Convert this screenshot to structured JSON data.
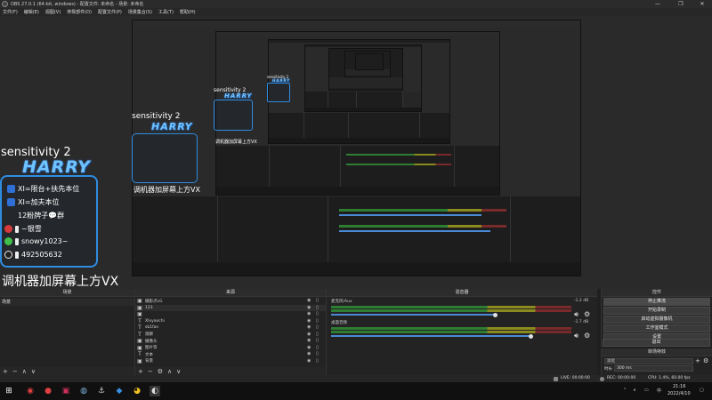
{
  "window": {
    "title": "OBS 27.0.1 (64-bit, windows) - 配置文件: 未命名 - 场景: 未命名",
    "controls": [
      "—",
      "❐",
      "✕"
    ]
  },
  "menu": [
    "文件(F)",
    "编辑(E)",
    "视图(V)",
    "停靠部件(D)",
    "配置文件(P)",
    "场景集合(S)",
    "工具(T)",
    "帮助(H)"
  ],
  "overlay": {
    "sensitivity": "sensitivity 2",
    "logo_text": "HARRY",
    "rows": [
      "XI=限台+扶先本位",
      "XI=加夫本位",
      "12粉牌子💬群",
      "~银雪",
      "snowy1023~",
      "492505632"
    ],
    "banner": "调机器加屏幕上方VX"
  },
  "docks": {
    "scenes": {
      "title": "场景",
      "items": [
        "场景"
      ],
      "footer": [
        "+",
        "−",
        "∧",
        "∨"
      ]
    },
    "sources": {
      "title": "来源",
      "items": [
        {
          "icon": "image",
          "label": "摄影点LG"
        },
        {
          "icon": "image",
          "label": "123"
        },
        {
          "icon": "image",
          "label": ""
        },
        {
          "icon": "text",
          "label": "XIxyaochi"
        },
        {
          "icon": "text",
          "label": "sb1fan"
        },
        {
          "icon": "text",
          "label": "观察"
        },
        {
          "icon": "image",
          "label": "摄像头"
        },
        {
          "icon": "image",
          "label": "图片等"
        },
        {
          "icon": "text",
          "label": "文本"
        },
        {
          "icon": "image",
          "label": "背景"
        }
      ],
      "footer": [
        "+",
        "−",
        "⚙",
        "∧",
        "∨"
      ]
    },
    "mixer": {
      "title": "混音器",
      "channels": [
        {
          "name": "麦克风/Aux",
          "db": "-1.2 dB",
          "volume": 0.68
        },
        {
          "name": "桌面音频",
          "db": "-1.7 dB",
          "volume": 0.83
        }
      ]
    },
    "controls": {
      "title": "控件",
      "buttons": [
        "停止推流",
        "开始录制",
        "启动虚拟摄像机",
        "工作室模式",
        "设置",
        "退出"
      ]
    },
    "transitions": {
      "title": "转场特效",
      "type": "淡化",
      "duration_label": "时长",
      "duration_value": "300 ms"
    }
  },
  "status": {
    "live": "LIVE: 00:00:00",
    "rec": "REC: 00:00:00",
    "cpu": "CPU: 1.4%, 60.00 fps"
  },
  "taskbar": {
    "time": "21:16",
    "date": "2022/4/10",
    "lang": "中"
  },
  "colors": {
    "accent": "#2f8de0",
    "meter_green": "#2e7d32",
    "meter_yellow": "#8a8a1e",
    "meter_red": "#7a2a2a",
    "slider": "#4a8ad4"
  }
}
